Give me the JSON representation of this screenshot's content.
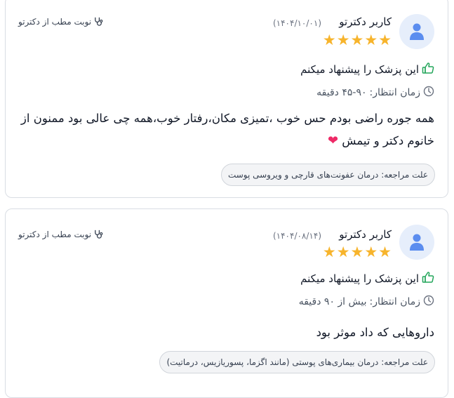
{
  "reviews": [
    {
      "author": "کاربر دکترتو",
      "date": "(۱۴۰۴/۱۰/۰۱)",
      "rating": 5,
      "booking_label": "نوبت مطب از دکترتو",
      "recommend_label": "این پزشک را پیشنهاد میکنم",
      "wait_label": "زمان انتظار:",
      "wait_value": "۴۵-۹۰ دقیقه",
      "comment": "همه جوره راضی بودم حس خوب ،تمیزی مکان،رفتار خوب،همه چی عالی بود ممنون از خانوم دکتر و تیمش",
      "comment_emoji": "❤",
      "reason_label": "علت مراجعه:",
      "reason_value": "درمان عفونت‌های قارچی و ویروسی پوست"
    },
    {
      "author": "کاربر دکترتو",
      "date": "(۱۴۰۴/۰۸/۱۴)",
      "rating": 5,
      "booking_label": "نوبت مطب از دکترتو",
      "recommend_label": "این پزشک را پیشنهاد میکنم",
      "wait_label": "زمان انتظار:",
      "wait_value": "بیش از ۹۰ دقیقه",
      "comment": "داروهایی که داد موثر بود",
      "comment_emoji": "",
      "reason_label": "علت مراجعه:",
      "reason_value": "درمان بیماری‌های پوستی (مانند اگزما، پسوریازیس، درماتیت)"
    }
  ],
  "colors": {
    "star": "#f7b42c",
    "thumb": "#22a55a",
    "avatar_bg": "#e6eefb",
    "avatar_icon": "#5b8def",
    "heart": "#ee2a67"
  },
  "icons": {
    "avatar": "user-icon",
    "booking": "stethoscope-icon",
    "recommend": "thumbs-up-icon",
    "wait": "clock-icon",
    "rating": "star-icon"
  }
}
